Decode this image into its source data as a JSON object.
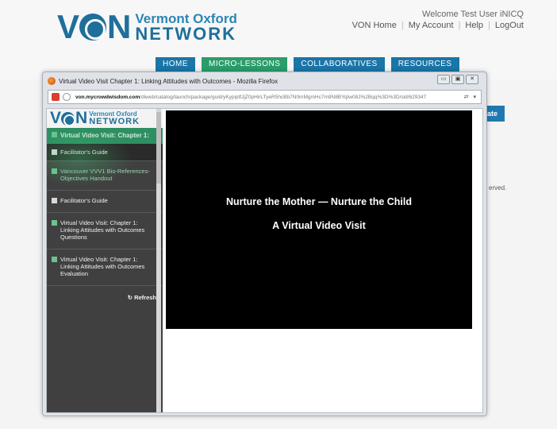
{
  "site": {
    "logo_top": "Vermont Oxford",
    "logo_bottom": "NETWORK",
    "welcome": "Welcome Test User iNICQ",
    "top_links": [
      "VON Home",
      "My Account",
      "Help",
      "LogOut"
    ],
    "nav": [
      "HOME",
      "MICRO-LESSONS",
      "COLLABORATIVES",
      "RESOURCES"
    ],
    "cutoff_button": "ate",
    "cutoff_text": "erved."
  },
  "popup": {
    "title": "Virtual Video Visit Chapter 1: Linking Attitudes with Outcomes - Mozilla Firefox",
    "url_domain": "von.mycrowdwisdom.com",
    "url_path": "/diweb/catalog/launch/package/guid/yKypiptfJjZ0pHirLTyeR5hcBb7N0mMgmHc7m9N8BYqIw08J%2Bqq%3D%3D/sid/629347",
    "sidebar": {
      "logo_top": "Vermont Oxford",
      "logo_bottom": "NETWORK",
      "header": "Virtual Video Visit: Chapter 1:",
      "items": [
        "Facilitator's Guide",
        "Vancouver VVV1 Bio-References-Objectives Handout",
        "Facilitator's Guide",
        "Virtual Video Visit: Chapter 1: Linking Attitudes with Outcomes Questions",
        "Virtual Video Visit: Chapter 1: Linking Attitudes with Outcomes Evaluation"
      ],
      "refresh": "Refresh"
    },
    "video": {
      "title": "Nurture the Mother — Nurture the Child",
      "subtitle": "A Virtual Video Visit"
    }
  },
  "colors": {
    "brand_blue": "#1f6f9b",
    "nav_blue": "#1a75a8",
    "nav_green": "#2a9d6b",
    "sidebar_bg": "#404040"
  }
}
